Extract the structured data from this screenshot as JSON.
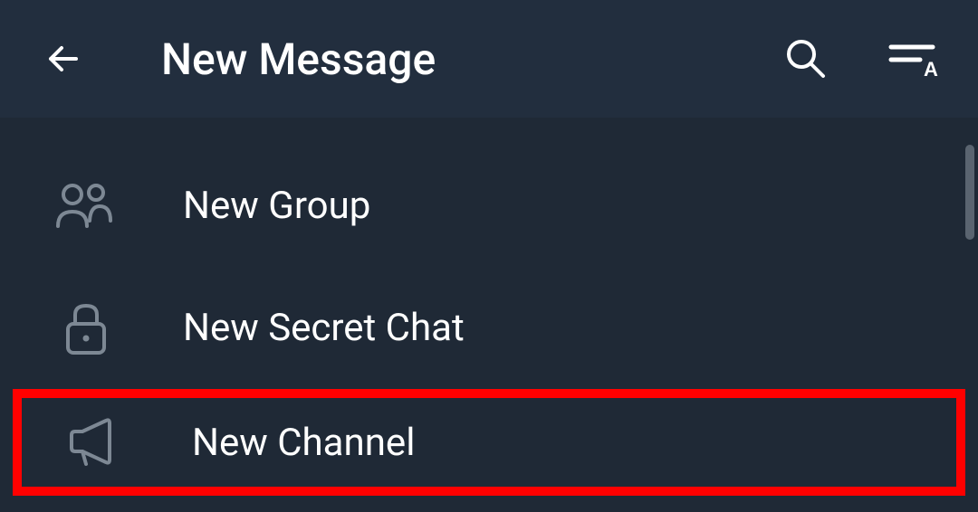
{
  "header": {
    "title": "New Message"
  },
  "options": {
    "newGroup": "New Group",
    "newSecretChat": "New Secret Chat",
    "newChannel": "New Channel"
  }
}
